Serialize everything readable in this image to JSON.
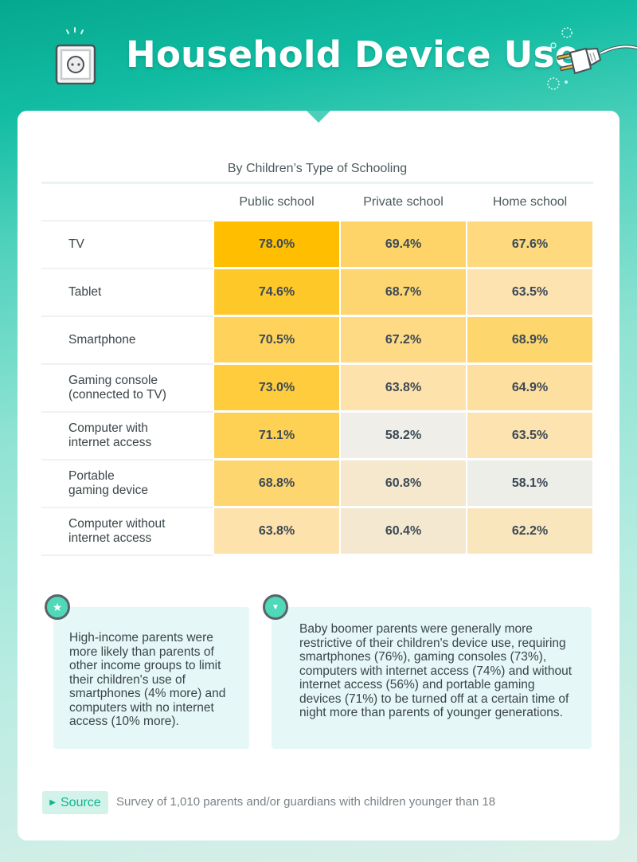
{
  "header": {
    "title": "Household Device Use",
    "left_icon": "power-outlet-icon",
    "right_icon": "electric-plug-icon"
  },
  "chart_data": {
    "type": "heatmap",
    "title": "Household Device Use",
    "subtitle": "By Children’s Type of Schooling",
    "columns": [
      "Public school",
      "Private school",
      "Home school"
    ],
    "rows": [
      "TV",
      "Tablet",
      "Smartphone",
      "Gaming console (connected to TV)",
      "Computer with internet access",
      "Portable gaming device",
      "Computer without internet access"
    ],
    "row_label_lines": [
      [
        "TV"
      ],
      [
        "Tablet"
      ],
      [
        "Smartphone"
      ],
      [
        "Gaming console",
        "(connected to TV)"
      ],
      [
        "Computer with",
        "internet access"
      ],
      [
        "Portable",
        "gaming device"
      ],
      [
        "Computer without",
        "internet access"
      ]
    ],
    "values": [
      [
        78.0,
        69.4,
        67.6
      ],
      [
        74.6,
        68.7,
        63.5
      ],
      [
        70.5,
        67.2,
        68.9
      ],
      [
        73.0,
        63.8,
        64.9
      ],
      [
        71.1,
        58.2,
        63.5
      ],
      [
        68.8,
        60.8,
        58.1
      ],
      [
        63.8,
        60.4,
        62.2
      ]
    ],
    "labels": [
      [
        "78.0%",
        "69.4%",
        "67.6%"
      ],
      [
        "74.6%",
        "68.7%",
        "63.5%"
      ],
      [
        "70.5%",
        "67.2%",
        "68.9%"
      ],
      [
        "73.0%",
        "63.8%",
        "64.9%"
      ],
      [
        "71.1%",
        "58.2%",
        "63.5%"
      ],
      [
        "68.8%",
        "60.8%",
        "58.1%"
      ],
      [
        "63.8%",
        "60.4%",
        "62.2%"
      ]
    ],
    "unit": "%",
    "color_scale": {
      "low": "#eeeeea",
      "mid": "#fde2aa",
      "high": "#ffbf00"
    },
    "value_range": [
      58,
      78
    ]
  },
  "notes": [
    {
      "icon": "star-icon",
      "text": "High-income parents were more likely than parents of other income groups to limit their children's use of smartphones (4% more) and computers with no internet access (10% more)."
    },
    {
      "icon": "chevron-down-icon",
      "text": "Baby boomer parents were generally more restrictive of their children's device use, requiring smartphones (76%), gaming consoles (73%), computers with internet access (74%) and without internet access (56%) and portable gaming devices (71%) to be turned off at a certain time of night more than parents of younger generations."
    }
  ],
  "source": {
    "label": "Source",
    "text": "Survey of 1,010 parents and/or guardians with children younger than 18"
  },
  "colors": {
    "accent": "#12b38f",
    "badge": "#4fd9b8",
    "note_bg": "#e6f7f7"
  }
}
